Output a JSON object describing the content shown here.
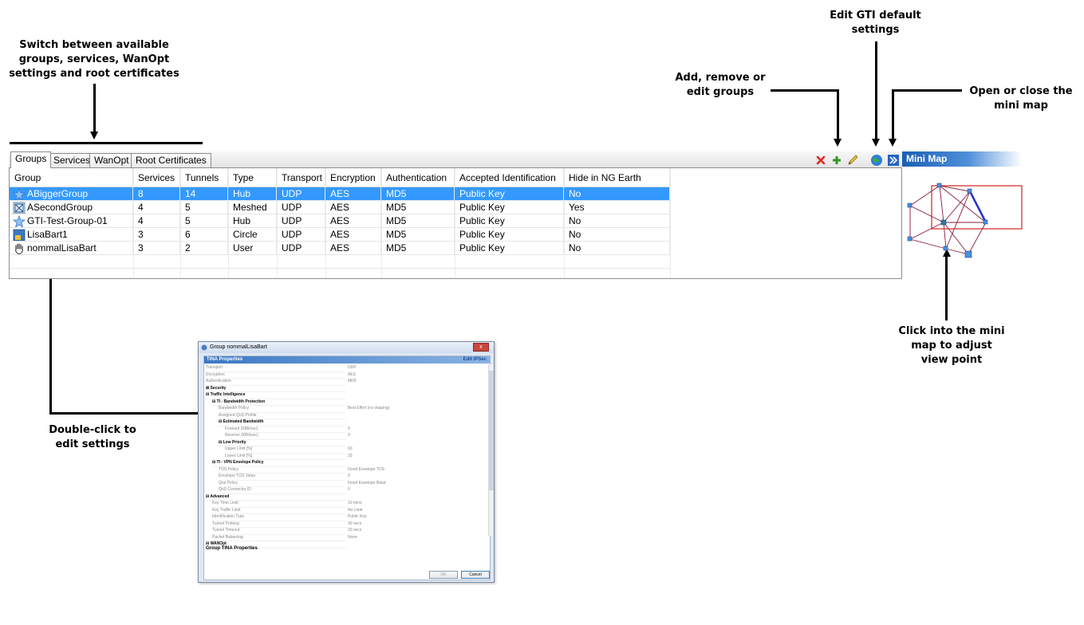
{
  "callouts": {
    "switch_tabs": [
      "Switch between available",
      "groups, services, WanOpt",
      "settings and root certificates"
    ],
    "edit_gti": [
      "Edit GTI default",
      "settings"
    ],
    "add_remove": [
      "Add, remove or",
      "edit groups"
    ],
    "open_minimap": [
      "Open or close the",
      "mini map"
    ],
    "click_minimap": [
      "Click into the mini",
      "map to adjust",
      "view point"
    ],
    "double_click": [
      "Double-click to",
      "edit settings"
    ]
  },
  "tabs": [
    "Groups",
    "Services",
    "WanOpt",
    "Root Certificates"
  ],
  "active_tab": "Groups",
  "toolbar": {
    "remove_icon": "red-x-icon",
    "add_icon": "green-plus-icon",
    "edit_icon": "pencil-icon",
    "gti_icon": "globe-icon",
    "minimap_toggle_icon": "double-chevron-right-icon"
  },
  "table": {
    "columns": [
      "Group",
      "Services",
      "Tunnels",
      "Type",
      "Transport",
      "Encryption",
      "Authentication",
      "Accepted Identification",
      "Hide in NG Earth"
    ],
    "rows": [
      {
        "icon": "star-icon",
        "cells": [
          "ABiggerGroup",
          "8",
          "14",
          "Hub",
          "UDP",
          "AES",
          "MD5",
          "Public Key",
          "No"
        ],
        "selected": true
      },
      {
        "icon": "mesh-icon",
        "cells": [
          "ASecondGroup",
          "4",
          "5",
          "Meshed",
          "UDP",
          "AES",
          "MD5",
          "Public Key",
          "Yes"
        ],
        "selected": false
      },
      {
        "icon": "star-icon",
        "cells": [
          "GTI-Test-Group-01",
          "4",
          "5",
          "Hub",
          "UDP",
          "AES",
          "MD5",
          "Public Key",
          "No"
        ],
        "selected": false
      },
      {
        "icon": "circle-icon",
        "cells": [
          "LisaBart1",
          "3",
          "6",
          "Circle",
          "UDP",
          "AES",
          "MD5",
          "Public Key",
          "No"
        ],
        "selected": false
      },
      {
        "icon": "hand-icon",
        "cells": [
          "nommalLisaBart",
          "3",
          "2",
          "User",
          "UDP",
          "AES",
          "MD5",
          "Public Key",
          "No"
        ],
        "selected": false
      }
    ]
  },
  "minimap": {
    "title": "Mini Map",
    "colors": {
      "edge": "#8b1a3a",
      "viewport": "#d42020",
      "highlight": "#2233cc",
      "node": "#4a8fe0"
    }
  },
  "dialog": {
    "title": "Group nommalLisaBart",
    "close": "x",
    "header": "TINA Properties",
    "edit_link": "Edit IPSec",
    "properties": [
      {
        "k": "Transport",
        "v": "UDP",
        "indent": 0,
        "sec": false
      },
      {
        "k": "Encryption",
        "v": "AES",
        "indent": 0,
        "sec": false
      },
      {
        "k": "Authentication",
        "v": "MD5",
        "indent": 0,
        "sec": false
      },
      {
        "k": "⊞  Security",
        "v": "",
        "indent": 0,
        "sec": true
      },
      {
        "k": "⊟  Traffic Intelligence",
        "v": "",
        "indent": 0,
        "sec": true
      },
      {
        "k": "⊟  TI - Bandwidth Protection",
        "v": "",
        "indent": 1,
        "sec": true
      },
      {
        "k": "Bandwidth Policy",
        "v": "Best Effort (no shaping)",
        "indent": 2,
        "sec": false
      },
      {
        "k": "Assigned QoS Profile",
        "v": "",
        "indent": 2,
        "sec": false
      },
      {
        "k": "⊟  Estimated Bandwidth",
        "v": "",
        "indent": 2,
        "sec": true
      },
      {
        "k": "Forward (KBit/sec)",
        "v": "0",
        "indent": 3,
        "sec": false
      },
      {
        "k": "Reverse (KBit/sec)",
        "v": "0",
        "indent": 3,
        "sec": false
      },
      {
        "k": "⊟  Low Priority",
        "v": "",
        "indent": 2,
        "sec": true
      },
      {
        "k": "Upper Limit [%]",
        "v": "60",
        "indent": 3,
        "sec": false
      },
      {
        "k": "Lower Limit [%]",
        "v": "20",
        "indent": 3,
        "sec": false
      },
      {
        "k": "⊟  TI - VPN Envelope Policy",
        "v": "",
        "indent": 1,
        "sec": true
      },
      {
        "k": "TOS Policy",
        "v": "Fixed Envelope TOS",
        "indent": 2,
        "sec": false
      },
      {
        "k": "Envelope TOS Value",
        "v": "0",
        "indent": 2,
        "sec": false
      },
      {
        "k": "Qos Policy",
        "v": "Fixed Envelope Band",
        "indent": 2,
        "sec": false
      },
      {
        "k": "QoS Connector ID",
        "v": "0",
        "indent": 2,
        "sec": false
      },
      {
        "k": "⊟  Advanced",
        "v": "",
        "indent": 0,
        "sec": true
      },
      {
        "k": "Key Time Limit",
        "v": "10 mins",
        "indent": 1,
        "sec": false
      },
      {
        "k": "Key Traffic Limit",
        "v": "No Limit",
        "indent": 1,
        "sec": false
      },
      {
        "k": "Identification Type",
        "v": "Public Key",
        "indent": 1,
        "sec": false
      },
      {
        "k": "Tunnel Probing",
        "v": "30 secs",
        "indent": 1,
        "sec": false
      },
      {
        "k": "Tunnel Timeout",
        "v": "20 secs",
        "indent": 1,
        "sec": false
      },
      {
        "k": "Packet Balancing",
        "v": "None",
        "indent": 1,
        "sec": false
      },
      {
        "k": "⊟  WANOpt",
        "v": "",
        "indent": 0,
        "sec": true
      }
    ],
    "description": "Group TINA Properties",
    "ok_label": "OK",
    "cancel_label": "Cancel"
  }
}
